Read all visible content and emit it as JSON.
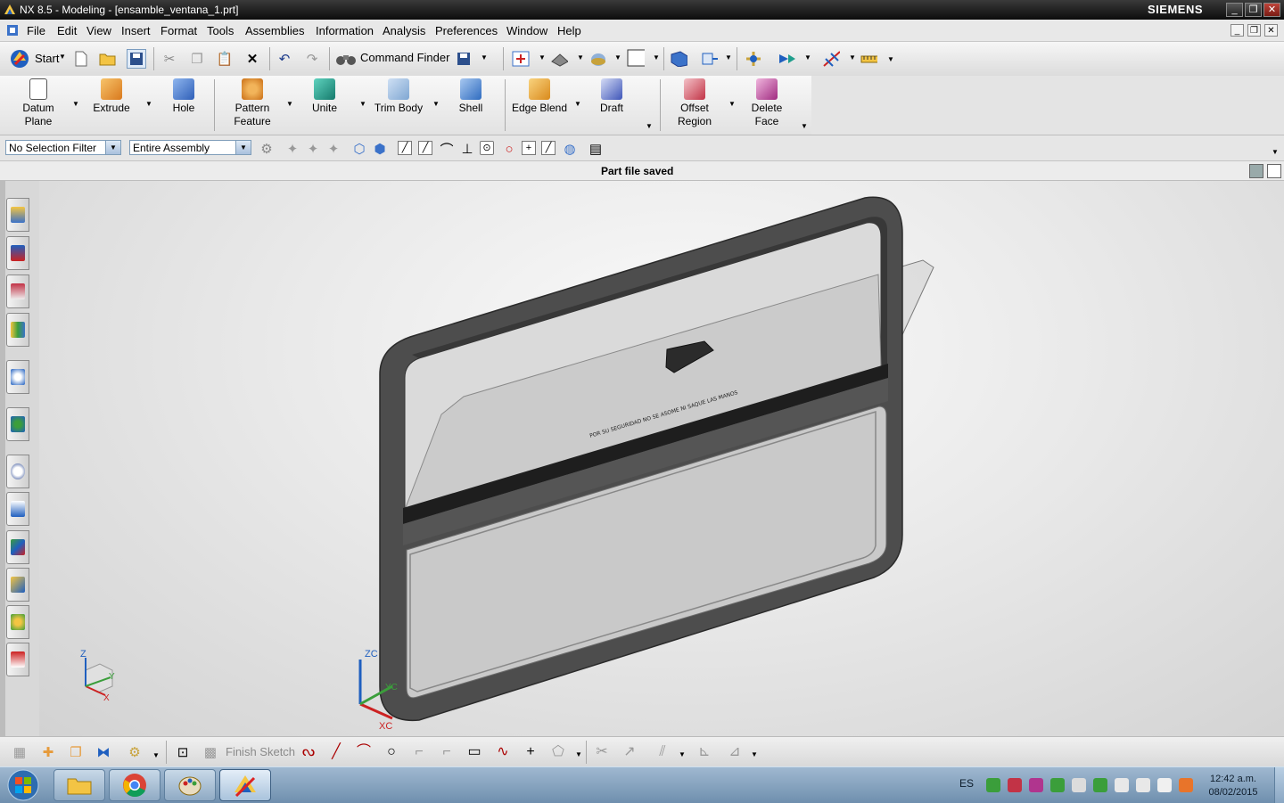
{
  "window": {
    "title": "NX 8.5 - Modeling - [ensamble_ventana_1.prt]",
    "brand": "SIEMENS"
  },
  "menu": [
    "File",
    "Edit",
    "View",
    "Insert",
    "Format",
    "Tools",
    "Assemblies",
    "Information",
    "Analysis",
    "Preferences",
    "Window",
    "Help"
  ],
  "toolbar": {
    "start_label": "Start",
    "command_finder_label": "Command Finder"
  },
  "features": [
    {
      "label": "Datum Plane",
      "color": "#ffffff"
    },
    {
      "label": "Extrude",
      "color": "#e6952b"
    },
    {
      "label": "Hole",
      "color": "#3b72c9"
    },
    {
      "label": "Pattern Feature",
      "color": "#e69a3a"
    },
    {
      "label": "Unite",
      "color": "#1f9e8c"
    },
    {
      "label": "Trim Body",
      "color": "#8fb6de"
    },
    {
      "label": "Shell",
      "color": "#4a8bd1"
    },
    {
      "label": "Edge Blend",
      "color": "#e8a83c"
    },
    {
      "label": "Draft",
      "color": "#4a63c9"
    },
    {
      "label": "Offset Region",
      "color": "#c9394d"
    },
    {
      "label": "Delete Face",
      "color": "#b0358e"
    }
  ],
  "selection": {
    "filter_value": "No Selection Filter",
    "scope_value": "Entire Assembly"
  },
  "status": {
    "message": "Part file saved"
  },
  "resource_bar": [
    "assembly-navigator-icon",
    "constraint-navigator-icon",
    "part-navigator-icon",
    "reuse-library-icon",
    "hd3d-tools-icon",
    "web-browser-icon",
    "history-icon",
    "process-studio-icon",
    "visualization-icon",
    "system-scenes-icon",
    "roles-icon",
    "system-materials-icon"
  ],
  "viewport": {
    "triad_labels": {
      "z": "Z",
      "x": "X",
      "y": "Y"
    },
    "csys_labels": {
      "zc": "ZC",
      "xc": "XC",
      "yc": "YC"
    },
    "glass_text": "POR SU SEGURIDAD NO SE ASOME NI SAQUE LAS MANOS"
  },
  "sketch": {
    "finish_label": "Finish Sketch"
  },
  "taskbar": {
    "language": "ES",
    "time": "12:42 a.m.",
    "date": "08/02/2015"
  },
  "colors": {
    "frame": "#4d4d4d",
    "accent": "#1f5fbf"
  }
}
